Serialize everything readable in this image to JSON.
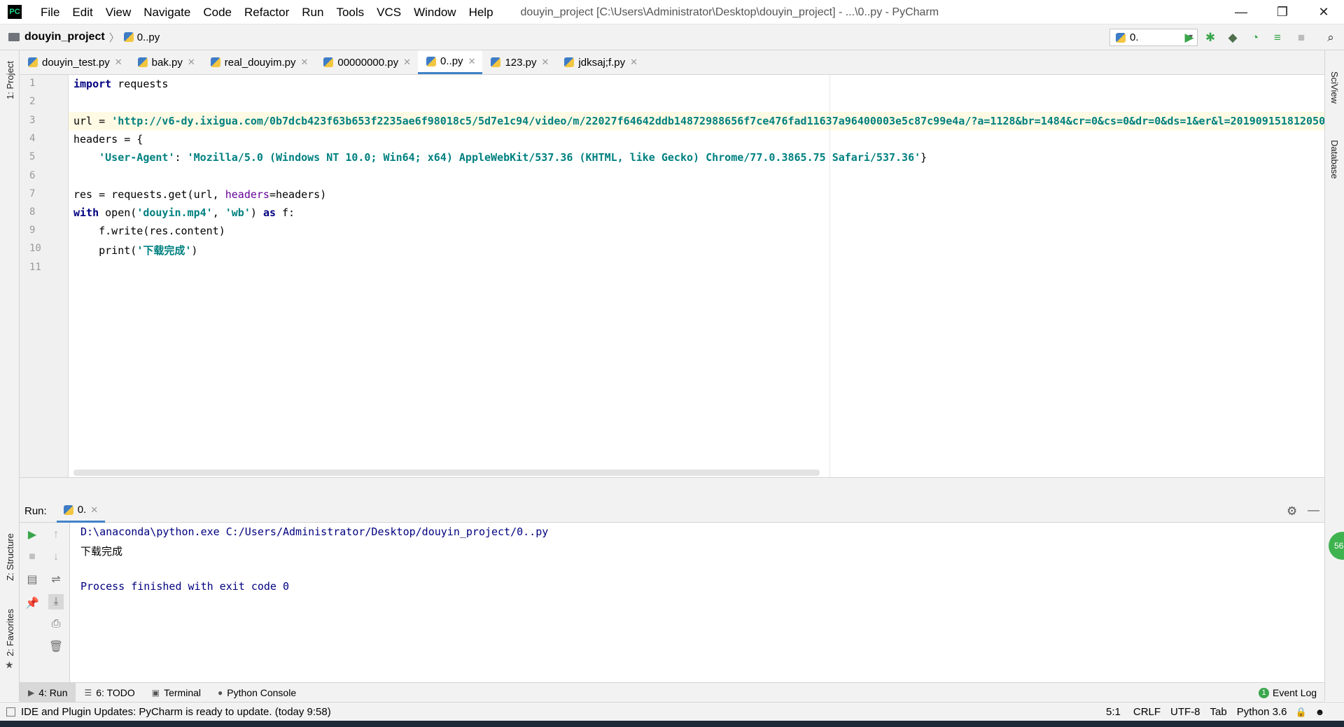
{
  "window": {
    "logo": "PC",
    "title": "douyin_project [C:\\Users\\Administrator\\Desktop\\douyin_project] - ...\\0..py - PyCharm",
    "minimize": "—",
    "restore": "❐",
    "close": "✕"
  },
  "menu": [
    "File",
    "Edit",
    "View",
    "Navigate",
    "Code",
    "Refactor",
    "Run",
    "Tools",
    "VCS",
    "Window",
    "Help"
  ],
  "navbar": {
    "project": "douyin_project",
    "separator": "〉",
    "file": "0..py",
    "run_config": "0.",
    "icons": [
      "run-icon",
      "debug-icon",
      "coverage-icon",
      "profile-icon",
      "concurrency-icon",
      "stop-icon",
      "search-icon"
    ]
  },
  "tabs": [
    {
      "label": "douyin_test.py",
      "active": false
    },
    {
      "label": "bak.py",
      "active": false
    },
    {
      "label": "real_douyim.py",
      "active": false
    },
    {
      "label": "00000000.py",
      "active": false
    },
    {
      "label": "0..py",
      "active": true
    },
    {
      "label": "123.py",
      "active": false
    },
    {
      "label": "jdksaj;f.py",
      "active": false
    }
  ],
  "tab_close": "✕",
  "side_left": {
    "project": "1: Project",
    "structure": "Z: Structure",
    "favorites": "2: Favorites"
  },
  "side_right": {
    "sciview": "SciView",
    "database": "Database"
  },
  "editor": {
    "line_numbers": [
      "1",
      "2",
      "3",
      "4",
      "5",
      "6",
      "7",
      "8",
      "9",
      "10",
      "11"
    ],
    "l1_kw": "import",
    "l1_rest": " requests",
    "l3_a": "url = ",
    "l3_str": "'http://v6-dy.ixigua.com/0b7dcb423f63b653f2235ae6f98018c5/5d7e1c94/video/m/22027f64642ddb14872988656f7ce476fad11637a96400003e5c87c99e4a/?a=1128&br=1484&cr=0&cs=0&dr=0&ds=1&er&l=2019091518120501",
    "l4": "headers = {",
    "l5_indent": "    ",
    "l5_key": "'User-Agent'",
    "l5_colon": ": ",
    "l5_val": "'Mozilla/5.0 (Windows NT 10.0; Win64; x64) AppleWebKit/537.36 (KHTML, like Gecko) Chrome/77.0.3865.75 Safari/537.36'",
    "l5_end": "}",
    "l7_a": "res = requests.get(url, ",
    "l7_param": "headers",
    "l7_b": "=headers)",
    "l8_kw1": "with",
    "l8_a": " open(",
    "l8_s1": "'douyin.mp4'",
    "l8_b": ", ",
    "l8_s2": "'wb'",
    "l8_c": ") ",
    "l8_kw2": "as",
    "l8_d": " f:",
    "l9": "    f.write(res.content)",
    "l10_a": "    print(",
    "l10_str": "'下载完成'",
    "l10_b": ")"
  },
  "run_panel": {
    "label": "Run:",
    "tab": "0.",
    "console": [
      "D:\\anaconda\\python.exe C:/Users/Administrator/Desktop/douyin_project/0..py",
      "下载完成",
      "",
      "Process finished with exit code 0"
    ],
    "colors": {
      "path": "#000080",
      "output": "#000000",
      "process": "#000080"
    }
  },
  "bottom_tools": [
    {
      "label": "4: Run",
      "icon": "▶",
      "active": true
    },
    {
      "label": "6: TODO",
      "icon": "☰",
      "active": false
    },
    {
      "label": "Terminal",
      "icon": "▣",
      "active": false
    },
    {
      "label": "Python Console",
      "icon": "●",
      "active": false
    }
  ],
  "event_log": {
    "badge": "1",
    "label": "Event Log"
  },
  "status": {
    "message": "IDE and Plugin Updates: PyCharm is ready to update. (today 9:58)",
    "position": "5:1",
    "line_sep": "CRLF",
    "encoding": "UTF-8",
    "indent": "Tab",
    "interpreter": "Python 3.6"
  },
  "notification": "56",
  "accent": "#4083c9"
}
